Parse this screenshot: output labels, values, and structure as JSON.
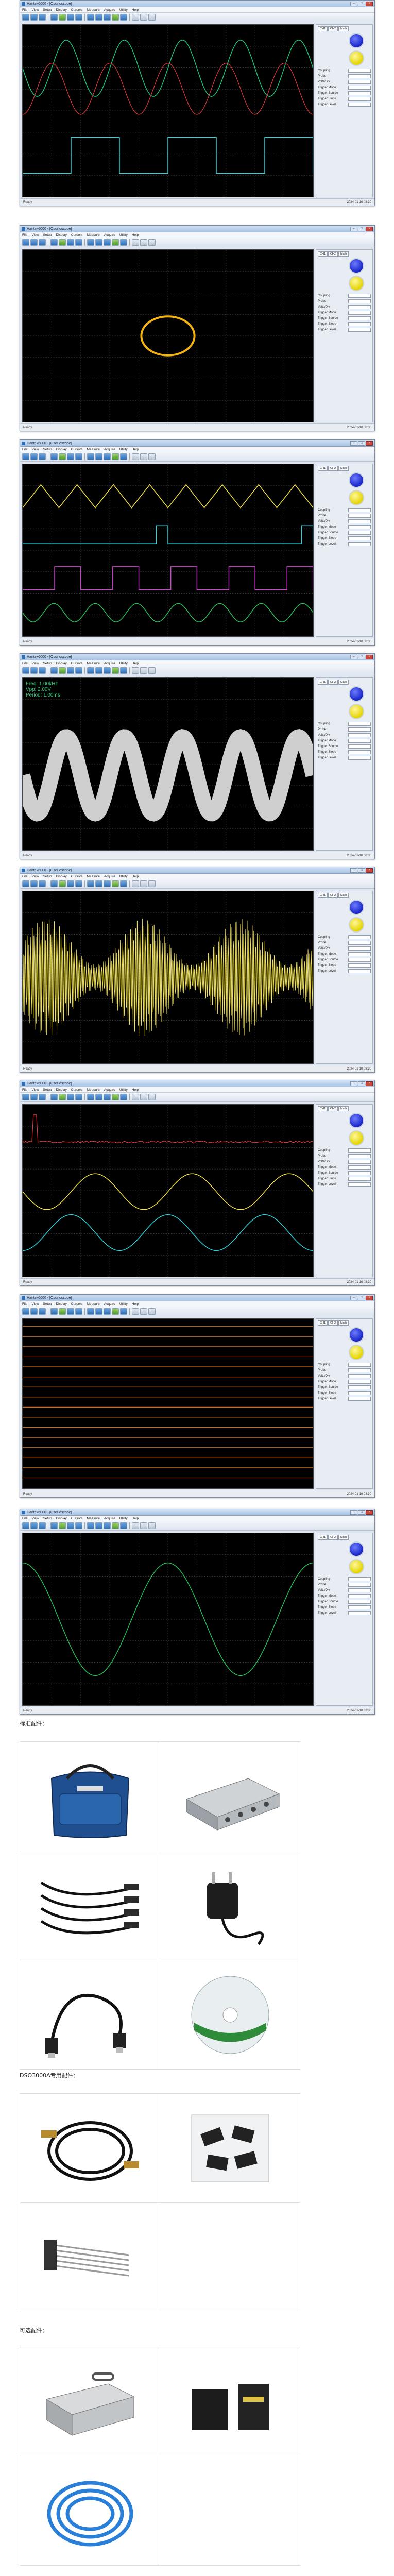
{
  "window": {
    "title": "Hantek6000 - [Oscilloscope]",
    "menu": [
      "File",
      "View",
      "Setup",
      "Display",
      "Cursors",
      "Measure",
      "Acquire",
      "Utility",
      "Help"
    ],
    "status_left": "Ready",
    "status_right": "2024-01-10 08:30"
  },
  "panel": {
    "tabs": [
      "CH1",
      "CH2",
      "Math"
    ],
    "rows": [
      "Coupling",
      "Probe",
      "Volts/Div",
      "Trigger Mode",
      "Trigger Source",
      "Trigger Slope",
      "Trigger Level"
    ]
  },
  "screens": [
    {
      "channels": [
        "CH1",
        "CH2",
        "CH3"
      ]
    },
    {
      "channels": [
        "CH1",
        "CH2"
      ]
    },
    {
      "channels": [
        "CH1",
        "CH2",
        "CH3",
        "CH4"
      ]
    },
    {
      "channels": [
        "CH1"
      ],
      "readouts": [
        "Freq: 1.00kHz",
        "Vpp: 2.00V",
        "Period: 1.00ms"
      ]
    },
    {
      "channels": [
        "CH1"
      ]
    },
    {
      "channels": [
        "CH1",
        "CH2",
        "FFT"
      ]
    },
    {
      "channels": [
        "D0-D15"
      ]
    },
    {
      "channels": [
        "CH1"
      ]
    }
  ],
  "sections": {
    "standard": "标准配件：",
    "dso3000": "DSO3000A专用配件：",
    "optional": "可选配件："
  },
  "accessories": {
    "standard": [
      "bag",
      "oscilloscope-unit",
      "probes",
      "power-adapter",
      "usb-cable",
      "software-cd"
    ],
    "dso3000": [
      "bnc-cable",
      "clip-adapters",
      "logic-cable"
    ],
    "optional": [
      "aluminium-case",
      "poe-adapter",
      "ethernet-cable"
    ]
  },
  "colors": {
    "ch1": "#f2e34c",
    "ch2": "#e23b3b",
    "ch3": "#2fd0d8",
    "ch4": "#d43fd4",
    "grid": "#3a3a3a"
  }
}
